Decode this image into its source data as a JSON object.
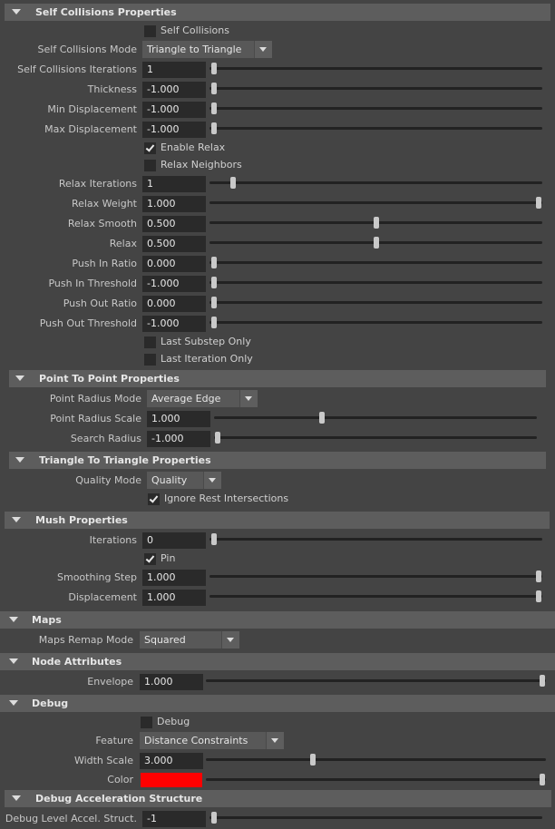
{
  "sections": {
    "self_collisions": "Self Collisions Properties",
    "point_to_point": "Point To Point Properties",
    "triangle_to_triangle": "Triangle To Triangle Properties",
    "mush": "Mush Properties",
    "maps": "Maps",
    "node_attributes": "Node Attributes",
    "debug": "Debug",
    "debug_accel": "Debug Acceleration Structure"
  },
  "self_collisions": {
    "self_collisions_check": {
      "label": "Self Collisions",
      "checked": false
    },
    "mode": {
      "label": "Self Collisions Mode",
      "value": "Triangle to Triangle"
    },
    "iterations": {
      "label": "Self Collisions Iterations",
      "value": "1",
      "slider": 0.0
    },
    "thickness": {
      "label": "Thickness",
      "value": "-1.000",
      "slider": 0.0
    },
    "min_displacement": {
      "label": "Min Displacement",
      "value": "-1.000",
      "slider": 0.0
    },
    "max_displacement": {
      "label": "Max Displacement",
      "value": "-1.000",
      "slider": 0.0
    },
    "enable_relax": {
      "label": "Enable Relax",
      "checked": true
    },
    "relax_neighbors": {
      "label": "Relax Neighbors",
      "checked": false
    },
    "relax_iterations": {
      "label": "Relax Iterations",
      "value": "1",
      "slider": 0.06
    },
    "relax_weight": {
      "label": "Relax Weight",
      "value": "1.000",
      "slider": 1.0
    },
    "relax_smooth": {
      "label": "Relax Smooth",
      "value": "0.500",
      "slider": 0.5
    },
    "relax": {
      "label": "Relax",
      "value": "0.500",
      "slider": 0.5
    },
    "push_in_ratio": {
      "label": "Push In Ratio",
      "value": "0.000",
      "slider": 0.0
    },
    "push_in_threshold": {
      "label": "Push In Threshold",
      "value": "-1.000",
      "slider": 0.0
    },
    "push_out_ratio": {
      "label": "Push Out Ratio",
      "value": "0.000",
      "slider": 0.0
    },
    "push_out_threshold": {
      "label": "Push Out Threshold",
      "value": "-1.000",
      "slider": 0.0
    },
    "last_substep_only": {
      "label": "Last Substep Only",
      "checked": false
    },
    "last_iteration_only": {
      "label": "Last Iteration Only",
      "checked": false
    }
  },
  "point_to_point": {
    "radius_mode": {
      "label": "Point Radius Mode",
      "value": "Average Edge"
    },
    "radius_scale": {
      "label": "Point Radius Scale",
      "value": "1.000",
      "slider": 0.33
    },
    "search_radius": {
      "label": "Search Radius",
      "value": "-1.000",
      "slider": 0.0
    }
  },
  "triangle_to_triangle": {
    "quality_mode": {
      "label": "Quality Mode",
      "value": "Quality"
    },
    "ignore_rest": {
      "label": "Ignore Rest Intersections",
      "checked": true
    }
  },
  "mush": {
    "iterations": {
      "label": "Iterations",
      "value": "0",
      "slider": 0.0
    },
    "pin": {
      "label": "Pin",
      "checked": true
    },
    "smoothing_step": {
      "label": "Smoothing Step",
      "value": "1.000",
      "slider": 1.0
    },
    "displacement": {
      "label": "Displacement",
      "value": "1.000",
      "slider": 1.0
    }
  },
  "maps": {
    "remap_mode": {
      "label": "Maps Remap Mode",
      "value": "Squared"
    }
  },
  "node_attributes": {
    "envelope": {
      "label": "Envelope",
      "value": "1.000",
      "slider": 1.0
    }
  },
  "debug": {
    "debug_check": {
      "label": "Debug",
      "checked": false
    },
    "feature": {
      "label": "Feature",
      "value": "Distance Constraints"
    },
    "width_scale": {
      "label": "Width Scale",
      "value": "3.000",
      "slider": 0.31
    },
    "color": {
      "label": "Color",
      "value": "#ff0000",
      "slider": 1.0
    }
  },
  "debug_accel": {
    "level": {
      "label": "Debug Level Accel. Struct.",
      "value": "-1",
      "slider": 0.0
    }
  }
}
